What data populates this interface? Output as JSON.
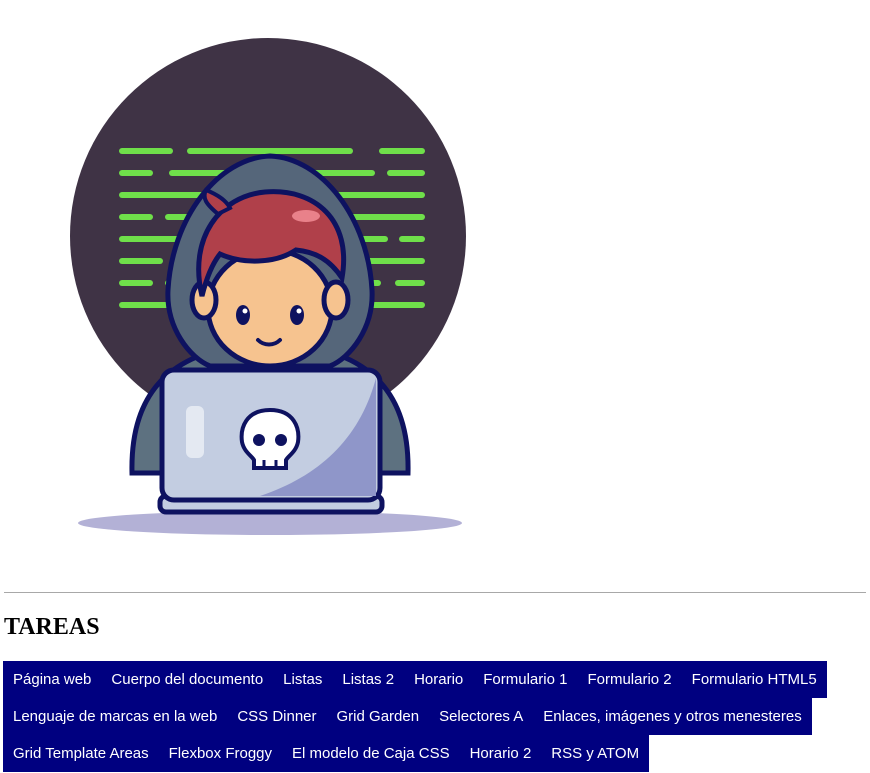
{
  "section": {
    "title": "TAREAS"
  },
  "tasks": {
    "rows": [
      [
        "Página web",
        "Cuerpo del documento",
        "Listas",
        "Listas 2",
        "Horario",
        "Formulario 1",
        "Formulario 2",
        "Formulario HTML5"
      ],
      [
        "Lenguaje de marcas en la web",
        "CSS Dinner",
        "Grid Garden",
        "Selectores A",
        "Enlaces, imágenes y otros menesteres"
      ],
      [
        "Grid Template Areas",
        "Flexbox Froggy",
        "El modelo de Caja CSS",
        "Horario 2",
        "RSS y ATOM"
      ]
    ]
  },
  "colors": {
    "nav_background": "#000080",
    "nav_text": "#ffffff",
    "hero_circle": "#3f3345",
    "code_lines": "#6fdf4a",
    "hair": "#b0404a",
    "hoodie": "#5d7180",
    "laptop": "#c3cde1"
  }
}
